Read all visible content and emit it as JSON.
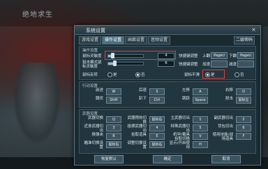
{
  "background": {
    "title": "绝地求生"
  },
  "dialog": {
    "title": "系统设置",
    "close_glyph": "×",
    "tabs": [
      "游戏设置",
      "操作设置",
      "画面设置",
      "音频设置"
    ],
    "active_tab": 1,
    "right_button": "二级密码"
  },
  "mouse_section": {
    "header": "操作设置",
    "sensitivity_label": "鼠标灵敏度",
    "sensitivity_value": "4",
    "sensitivity_level": 0.12,
    "scope_label": "狙击模式鼠标灵敏度",
    "scope_value": "6",
    "scope_level": 0.18,
    "invert_label": "鼠标反转",
    "invert_options": [
      "是",
      "否"
    ],
    "invert_selected": "否",
    "quick_switch_label": "快捷键调整",
    "quick_switch_key1_prefix": "上翻",
    "quick_switch_key1": "PageU",
    "quick_switch_key2_prefix": "下翻",
    "quick_switch_key2": "PageU",
    "quick_adjust_label": "快捷键调整",
    "quick_adjust_prefix1": "加速",
    "quick_adjust_key1": "",
    "quick_adjust_prefix2": "减速",
    "quick_adjust_key2": "",
    "smooth_label": "鼠标平滑",
    "smooth_options": [
      "是",
      "否"
    ],
    "smooth_selected": "是"
  },
  "move_section": {
    "header": "行动设置",
    "rows": [
      [
        {
          "label": "前进",
          "key": "W"
        },
        {
          "label": "后退",
          "key": "S"
        },
        {
          "label": "左移",
          "key": "A"
        },
        {
          "label": "右移",
          "key": "D"
        }
      ],
      [
        {
          "label": "蹲伏",
          "key": "Shift"
        },
        {
          "label": "趴下",
          "key": "Ctrl"
        },
        {
          "label": "跳跃",
          "key": "Space"
        },
        {
          "label": "射击",
          "key": "鼠标左"
        }
      ]
    ]
  },
  "weapon_section": {
    "header": "武器设置",
    "rows": [
      [
        {
          "label": "武器切换",
          "key": "Q"
        },
        {
          "label": "武器预热切换",
          "key": "鼠标右"
        },
        {
          "label": "主武器切出",
          "key": "1"
        },
        {
          "label": "副武器切出",
          "key": "2"
        }
      ],
      [
        {
          "label": "近身武器切出",
          "key": "3"
        },
        {
          "label": "投掷武器切出",
          "key": "4"
        },
        {
          "label": "特殊武器切出",
          "key": "5"
        },
        {
          "label": "背包切出",
          "key": "6"
        }
      ],
      [
        {
          "label": "换弹夹",
          "key": "R"
        },
        {
          "label": "拾取道具",
          "key": "E"
        },
        {
          "label": "机甲/载具 拾取切换",
          "key": "V"
        },
        {
          "label": "使用技能/战场道具",
          "key": "F"
        }
      ],
      [
        {
          "label": "瞄准切换设置",
          "key": "鼠标右"
        },
        {
          "label": "调整切换设置",
          "key": "鼠标右"
        },
        {
          "label": "显示/开启使用",
          "key": "H"
        }
      ]
    ]
  },
  "buttons": {
    "default": "恢复默认",
    "confirm": "确定",
    "cancel": "取消"
  },
  "colors": {
    "highlight": "#e33c3c",
    "dialog_bg": "#1b2a31"
  }
}
